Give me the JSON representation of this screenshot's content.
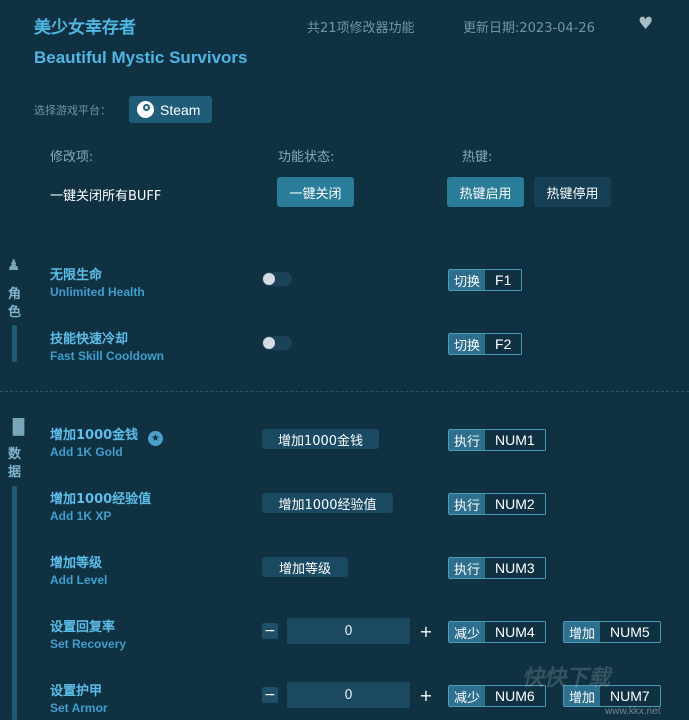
{
  "header": {
    "title_cn": "美少女幸存者",
    "title_en": "Beautiful Mystic Survivors",
    "feature_count": "共21项修改器功能",
    "update_date": "更新日期:2023-04-26"
  },
  "platform": {
    "label": "选择游戏平台：",
    "steam_label": "Steam"
  },
  "columns": {
    "item": "修改项:",
    "status": "功能状态:",
    "hotkey": "热键:"
  },
  "global_row": {
    "label": "一键关闭所有BUFF",
    "close_btn": "一键关闭",
    "enable_btn": "热键启用",
    "disable_btn": "热键停用"
  },
  "sections": [
    {
      "name_line1": "角",
      "name_line2": "色"
    },
    {
      "name_line1": "数",
      "name_line2": "据"
    }
  ],
  "role_rows": [
    {
      "cn": "无限生命",
      "en": "Unlimited Health",
      "hk_action": "切换",
      "hk_key": "F1"
    },
    {
      "cn": "技能快速冷却",
      "en": "Fast Skill Cooldown",
      "hk_action": "切换",
      "hk_key": "F2"
    }
  ],
  "data_rows": [
    {
      "cn": "增加1000金钱",
      "en": "Add 1K Gold",
      "btn": "增加1000金钱",
      "hk_action": "执行",
      "hk_key": "NUM1"
    },
    {
      "cn": "增加1000经验值",
      "en": "Add 1K XP",
      "btn": "增加1000经验值",
      "hk_action": "执行",
      "hk_key": "NUM2"
    },
    {
      "cn": "增加等级",
      "en": "Add Level",
      "btn": "增加等级",
      "hk_action": "执行",
      "hk_key": "NUM3"
    }
  ],
  "stepper_rows": [
    {
      "cn": "设置回复率",
      "en": "Set Recovery",
      "value": "0",
      "minus": "−",
      "plus": "+",
      "dec_action": "减少",
      "dec_key": "NUM4",
      "inc_action": "增加",
      "inc_key": "NUM5"
    },
    {
      "cn": "设置护甲",
      "en": "Set Armor",
      "value": "0",
      "minus": "−",
      "plus": "+",
      "dec_action": "减少",
      "dec_key": "NUM6",
      "inc_action": "增加",
      "inc_key": "NUM7"
    }
  ],
  "watermark": {
    "logo": "快快下载",
    "url": "www.kkx.net"
  }
}
